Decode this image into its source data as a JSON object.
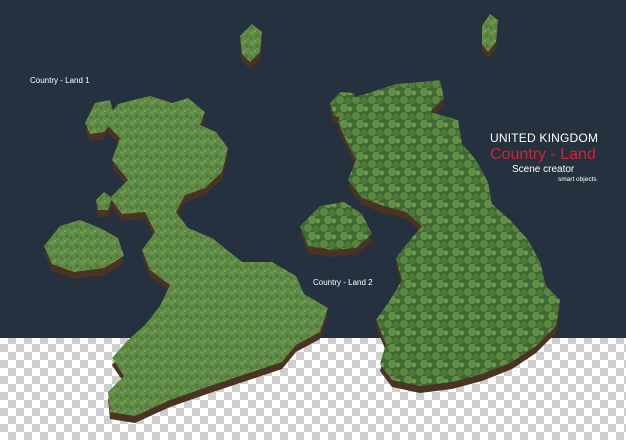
{
  "labels": {
    "land1": "Country - Land 1",
    "land2": "Country - Land 2"
  },
  "heading": {
    "title": "UNITED KINGDOM",
    "subtitle": "Country - Land",
    "line3": "Scene creator",
    "line4": "smart objects"
  },
  "colors": {
    "panel": "#25313f",
    "accent_red": "#d7202a",
    "grass": "#5f8a45",
    "trees": "#4a7536",
    "soil": "#4a3322"
  },
  "background": "transparency-checkerboard"
}
